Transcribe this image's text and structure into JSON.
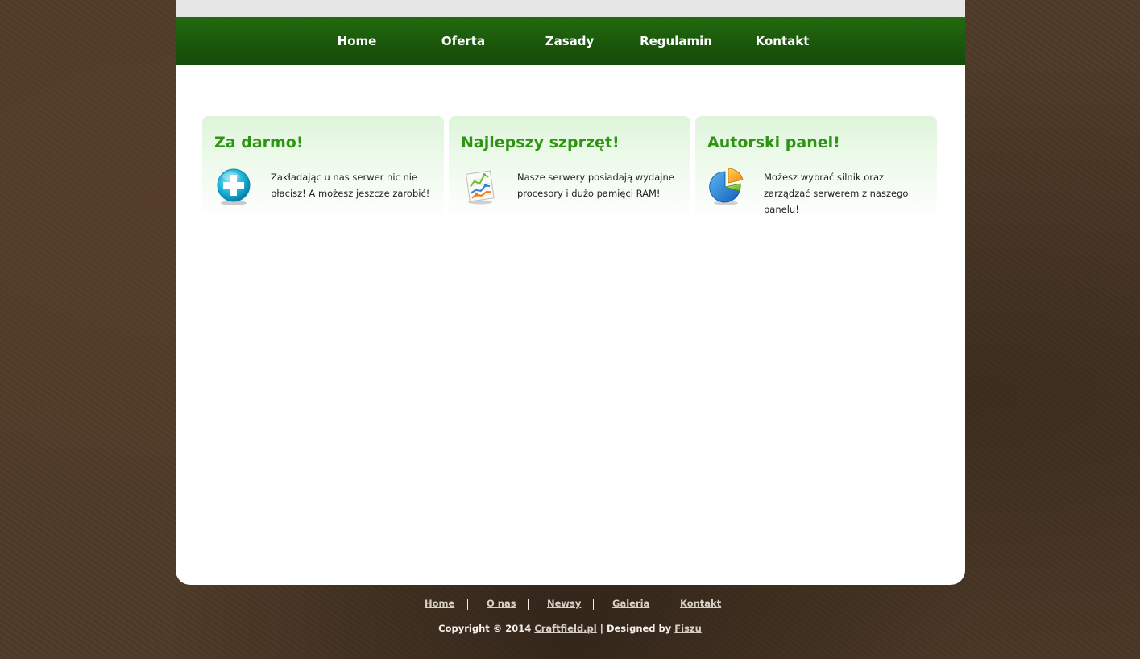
{
  "nav": {
    "items": [
      {
        "label": "Home"
      },
      {
        "label": "Oferta"
      },
      {
        "label": "Zasady"
      },
      {
        "label": "Regulamin"
      },
      {
        "label": "Kontakt"
      }
    ]
  },
  "features": [
    {
      "title": "Za darmo!",
      "icon": "plus-circle-icon",
      "text": "Zakładając u nas serwer nic nie płacisz! A możesz jeszcze zarobić!"
    },
    {
      "title": "Najlepszy szprzęt!",
      "icon": "line-chart-icon",
      "text": "Nasze serwery posiadają wydajne procesory i dużo pamięci RAM!"
    },
    {
      "title": "Autorski panel!",
      "icon": "pie-chart-icon",
      "text": "Możesz wybrać silnik oraz zarządzać serwerem z naszego panelu!"
    }
  ],
  "footer": {
    "links": [
      {
        "label": "Home"
      },
      {
        "label": "O nas"
      },
      {
        "label": "Newsy"
      },
      {
        "label": "Galeria"
      },
      {
        "label": "Kontakt"
      }
    ],
    "copyright_prefix": "Copyright © 2014",
    "site_link": "Craftfield.pl",
    "designed_by_prefix": "| Designed by",
    "designer_link": "Fiszu"
  },
  "colors": {
    "nav_green": "#1a560b",
    "title_green": "#2e9414",
    "background_brown": "#4e3a28"
  }
}
